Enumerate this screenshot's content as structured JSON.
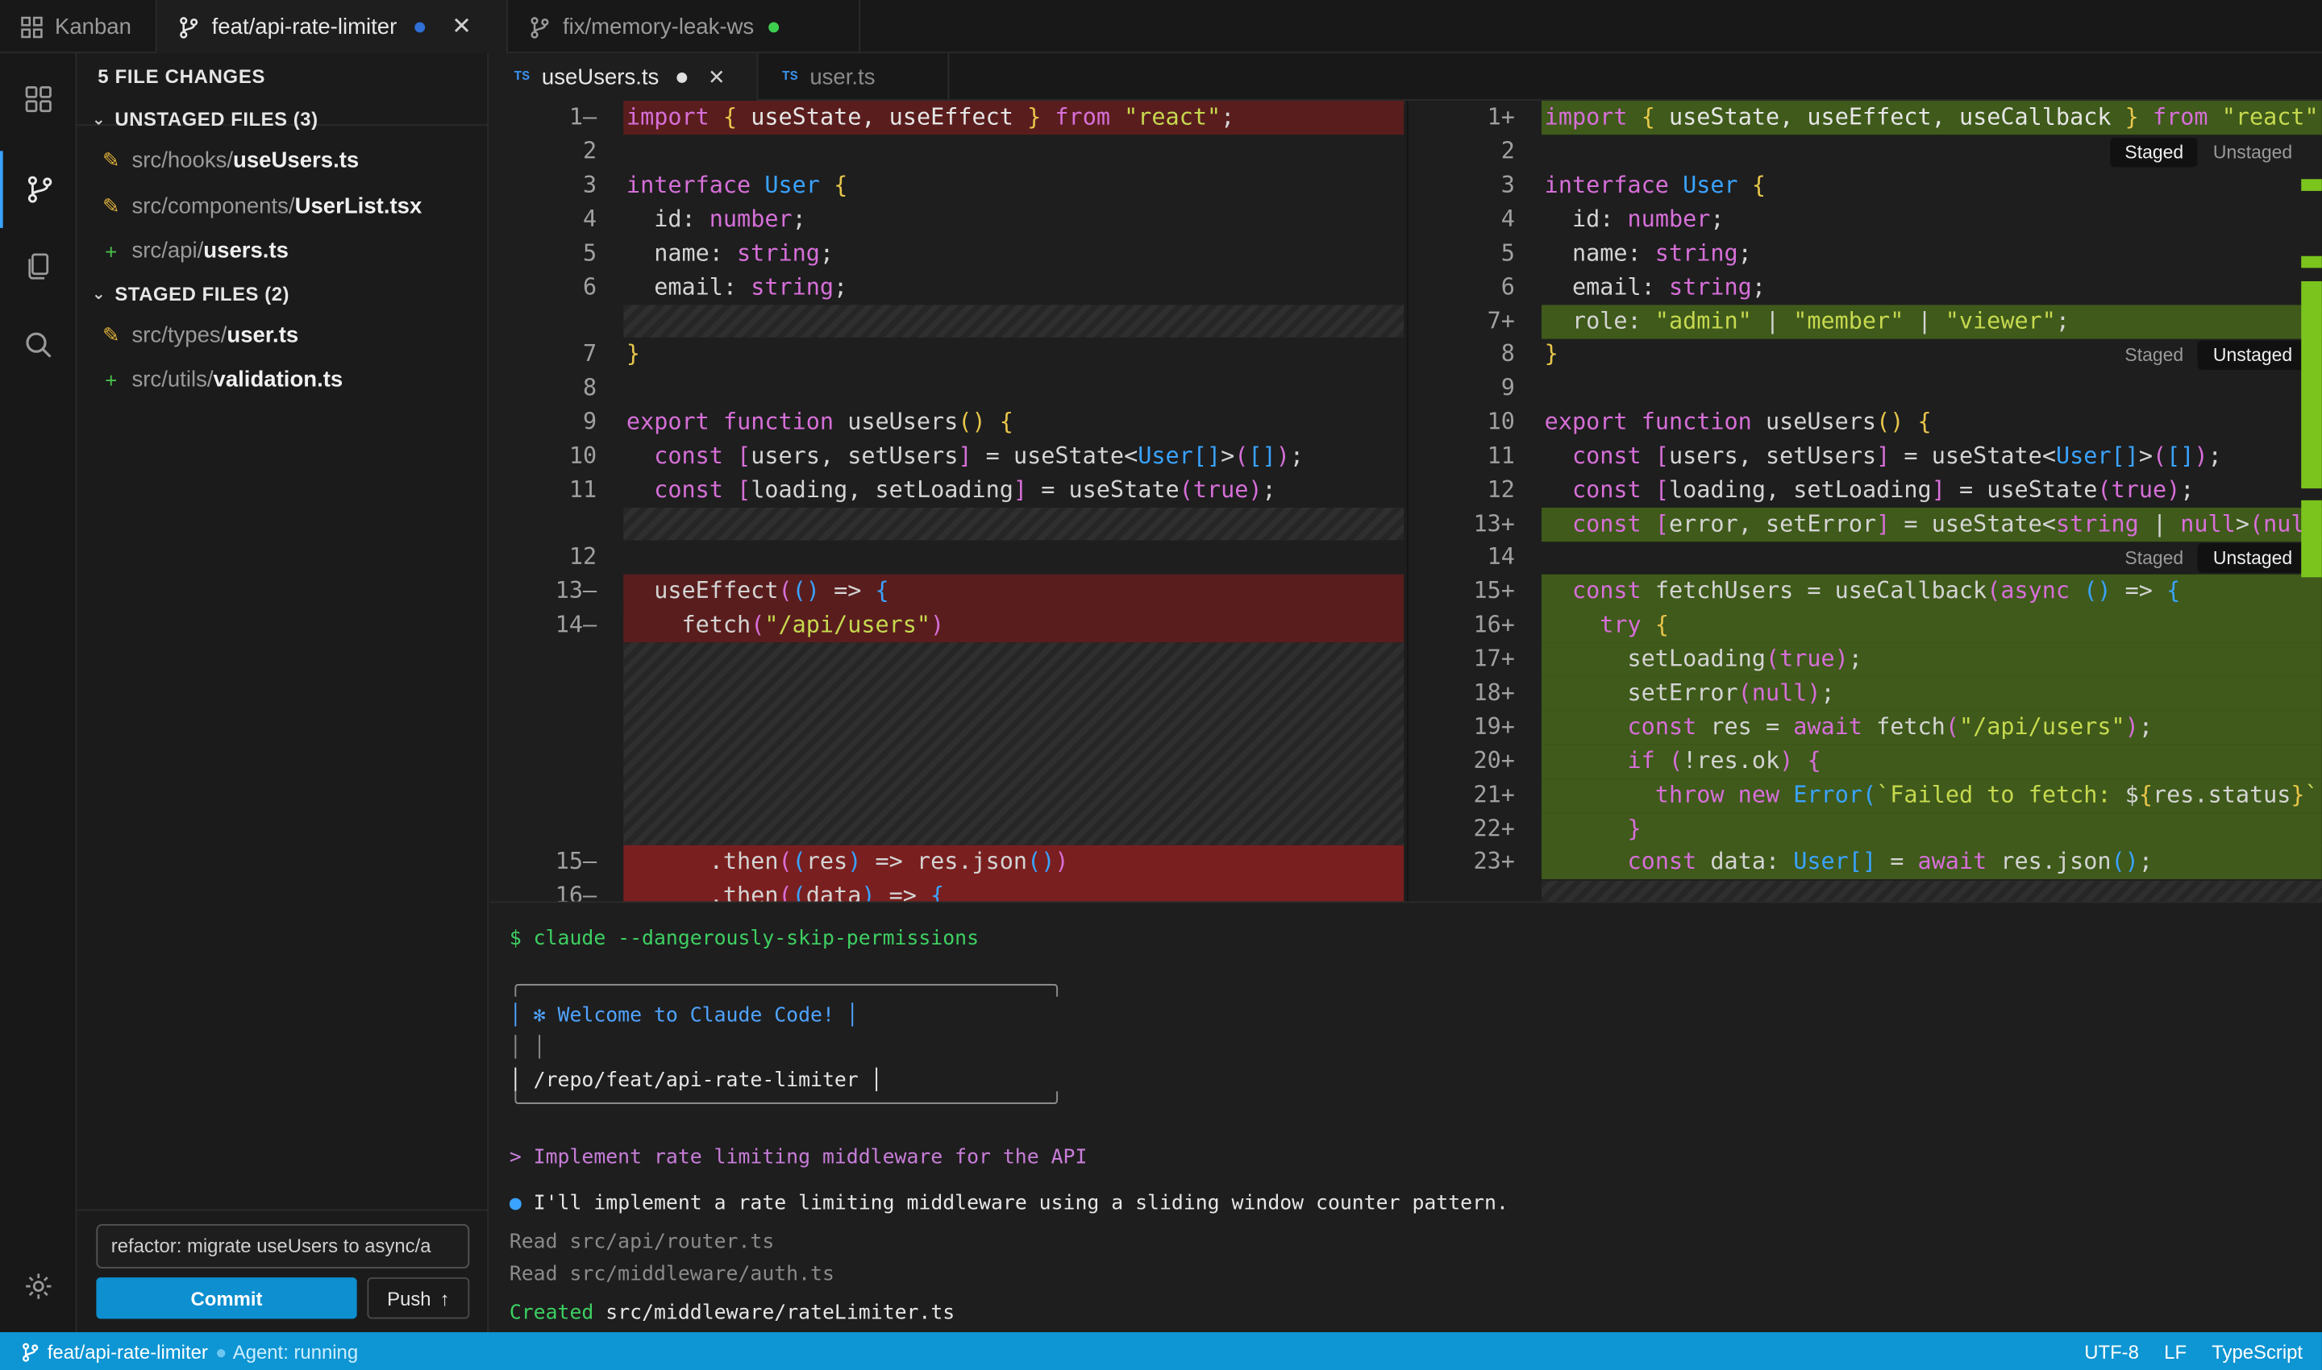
{
  "top_tabs": [
    {
      "label": "Kanban",
      "icon": "grid-icon"
    },
    {
      "label": "feat/api-rate-limiter",
      "icon": "git-branch-icon",
      "status_color": "#2f6fd6"
    },
    {
      "label": "fix/memory-leak-ws",
      "icon": "git-branch-icon",
      "status_color": "#3fcf4f"
    }
  ],
  "sidebar": {
    "title": "5 FILE CHANGES",
    "unstaged": {
      "label": "UNSTAGED FILES (3)",
      "files": [
        {
          "dir": "src/hooks/",
          "name": "useUsers.ts",
          "icon": "pencil-icon"
        },
        {
          "dir": "src/components/",
          "name": "UserList.tsx",
          "icon": "pencil-icon"
        },
        {
          "dir": "src/api/",
          "name": "users.ts",
          "icon": "plus-icon"
        }
      ]
    },
    "staged": {
      "label": "STAGED FILES (2)",
      "files": [
        {
          "dir": "src/types/",
          "name": "user.ts",
          "icon": "pencil-icon"
        },
        {
          "dir": "src/utils/",
          "name": "validation.ts",
          "icon": "plus-icon"
        }
      ]
    },
    "commit_message": "refactor: migrate useUsers to async/a",
    "commit_label": "Commit",
    "push_label": "Push"
  },
  "editor_tabs": [
    {
      "badge": "TS",
      "label": "useUsers.ts"
    },
    {
      "badge": "TS",
      "label": "user.ts"
    }
  ],
  "diff": {
    "left_line_numbers": [
      "1–",
      "2",
      "3",
      "4",
      "5",
      "6",
      "7",
      "8",
      "9",
      "10",
      "11",
      "12",
      "13–",
      "14–",
      "15–",
      "16–"
    ],
    "right_line_numbers": [
      "1+",
      "2",
      "3",
      "4",
      "5",
      "6",
      "7+",
      "8",
      "9",
      "10",
      "11",
      "12",
      "13+",
      "14",
      "15+",
      "16+",
      "17+",
      "18+",
      "19+",
      "20+",
      "21+",
      "22+",
      "23+"
    ],
    "staged_label": "Staged",
    "unstaged_label": "Unstaged"
  },
  "terminal": {
    "command": "$ claude --dangerously-skip-permissions",
    "box_top": "╭────────────────────────────────────────────╮",
    "box_line1": "│ ✻ Welcome to Claude Code! │",
    "box_line2": "│ │",
    "box_line3": "│ /repo/feat/api-rate-limiter │",
    "box_bottom": "╰────────────────────────────────────────────╯",
    "prompt": "> Implement rate limiting middleware for the API",
    "response": "I'll implement a rate limiting middleware using a sliding window counter pattern.",
    "read1": "Read src/api/router.ts",
    "read2": "Read src/middleware/auth.ts",
    "created_label": "Created",
    "created_path": "src/middleware/rateLimiter.ts"
  },
  "status_bar": {
    "branch": "feat/api-rate-limiter",
    "agent": "Agent: running",
    "encoding": "UTF-8",
    "eol": "LF",
    "language": "TypeScript"
  },
  "colors": {
    "accent": "#0e95d3",
    "deleted_bg": "#5a1d1d",
    "added_bg": "#3f5a1a"
  }
}
